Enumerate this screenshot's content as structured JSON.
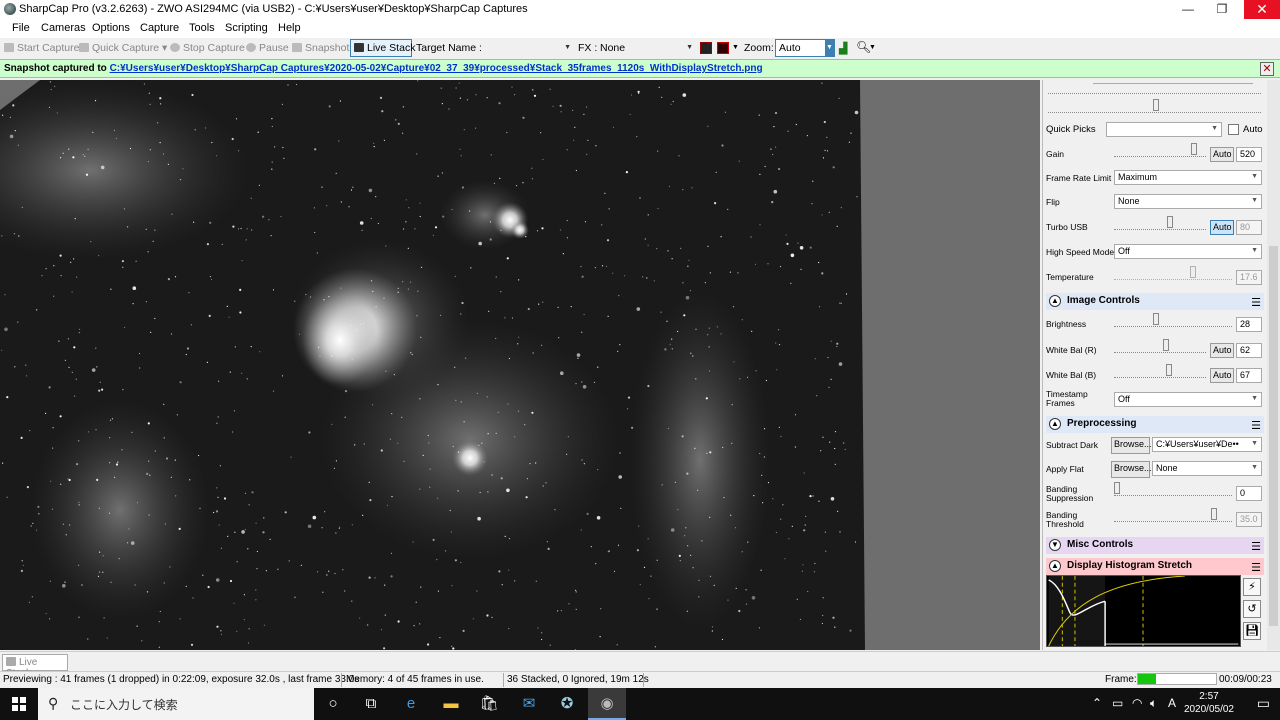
{
  "titlebar": {
    "title": "SharpCap Pro (v3.2.6263) - ZWO ASI294MC (via USB2) - C:¥Users¥user¥Desktop¥SharpCap Captures",
    "minimize": "—",
    "maximize": "❐",
    "close": "✕"
  },
  "menu": [
    "File",
    "Cameras",
    "Options",
    "Capture",
    "Tools",
    "Scripting",
    "Help"
  ],
  "toolbar": {
    "start_capture": "Start Capture",
    "quick_capture": "Quick Capture",
    "stop_capture": "Stop Capture",
    "pause": "Pause",
    "snapshot": "Snapshot",
    "live_stack": "Live Stack",
    "target_name_label": "Target Name :",
    "target_name_value": "",
    "fx_label": "FX :",
    "fx_value": "None",
    "zoom_label": "Zoom:",
    "zoom_value": "Auto"
  },
  "notification": {
    "prefix": "Snapshot captured to ",
    "path": "C:¥Users¥user¥Desktop¥SharpCap Captures¥2020-05-02¥Capture¥02_37_39¥processed¥Stack_35frames_1120s_WithDisplayStretch.png",
    "close": "✕"
  },
  "panel": {
    "quick_picks_label": "Quick Picks",
    "quick_picks_value": "",
    "auto_label": "Auto",
    "gain": {
      "label": "Gain",
      "auto": "Auto",
      "value": "520",
      "level": 0.9
    },
    "frame_rate_limit": {
      "label": "Frame Rate Limit",
      "value": "Maximum"
    },
    "flip": {
      "label": "Flip",
      "value": "None"
    },
    "turbo_usb": {
      "label": "Turbo USB",
      "auto": "Auto",
      "value": "80",
      "level": 0.62
    },
    "high_speed_mode": {
      "label": "High Speed Mode",
      "value": "Off"
    },
    "temperature": {
      "label": "Temperature",
      "value": "17.6",
      "level": 0.68
    },
    "image_controls": {
      "title": "Image Controls"
    },
    "brightness": {
      "label": "Brightness",
      "value": "28",
      "level": 0.35
    },
    "white_bal_r": {
      "label": "White Bal (R)",
      "auto": "Auto",
      "value": "62",
      "level": 0.57
    },
    "white_bal_b": {
      "label": "White Bal (B)",
      "auto": "Auto",
      "value": "67",
      "level": 0.6
    },
    "timestamp_frames": {
      "label1": "Timestamp",
      "label2": "Frames",
      "value": "Off"
    },
    "preprocessing": {
      "title": "Preprocessing"
    },
    "subtract_dark": {
      "label": "Subtract Dark",
      "browse": "Browse...",
      "value": "C:¥Users¥user¥De••"
    },
    "apply_flat": {
      "label": "Apply Flat",
      "browse": "Browse...",
      "value": "None"
    },
    "banding_suppression": {
      "label1": "Banding",
      "label2": "Suppression",
      "value": "0",
      "level": 0.0
    },
    "banding_threshold": {
      "label1": "Banding",
      "label2": "Threshold",
      "value": "35.0",
      "level": 0.87
    },
    "misc_controls": {
      "title": "Misc Controls"
    },
    "display_histogram": {
      "title": "Display Histogram Stretch"
    }
  },
  "tabs": {
    "live_stack": "Live Stack"
  },
  "status": {
    "preview": "Previewing : 41 frames (1 dropped) in 0:22:09, exposure 32.0s , last frame 33.0s",
    "memory": "Memory: 4 of 45 frames in use.",
    "stacked": "36 Stacked, 0 Ignored, 19m 12s",
    "frame_label": "Frame:",
    "frame_progress": 0.23,
    "frame_time": "00:09/00:23"
  },
  "taskbar": {
    "search_placeholder": "ここに入力して検索",
    "time": "2:57",
    "date": "2020/05/02",
    "ime": "A"
  },
  "colors": {
    "notify_bg": "#ccffcc",
    "image_controls_bg": "#dfe8f7",
    "preprocessing_bg": "#dfe8f7",
    "misc_controls_bg": "#e6d6f2",
    "display_hist_bg": "#ffc8cc",
    "close_red": "#e81123"
  }
}
